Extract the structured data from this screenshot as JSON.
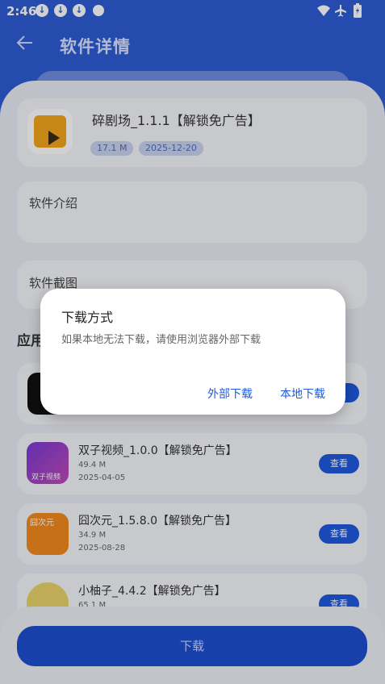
{
  "status_bar": {
    "time": "2:46"
  },
  "header": {
    "title": "软件详情"
  },
  "app": {
    "name": "碎剧场_1.1.1【解锁免广告】",
    "size": "17.1 M",
    "date": "2025-12-20"
  },
  "sections": {
    "intro": "软件介绍",
    "screenshots": "软件截图",
    "related_prefix": "应用"
  },
  "related": [
    {
      "name": "双子视频_1.0.0【解锁免广告】",
      "size": "49.4 M",
      "date": "2025-04-05",
      "icon_text": "双子视频",
      "button": "查看"
    },
    {
      "name": "囧次元_1.5.8.0【解锁免广告】",
      "size": "34.9 M",
      "date": "2025-08-28",
      "icon_text": "囧次元",
      "button": "查看"
    },
    {
      "name": "小柚子_4.4.2【解锁免广告】",
      "size": "65.1 M",
      "date": "",
      "button": "查看"
    }
  ],
  "bottom": {
    "download_label": "下载"
  },
  "dialog": {
    "title": "下载方式",
    "message": "如果本地无法下载，请使用浏览器外部下载",
    "external_button": "外部下载",
    "local_button": "本地下载"
  },
  "colors": {
    "header_bg": "#2f5cd6",
    "accent": "#1e5ae0",
    "sheet_bg": "#e9ecf5"
  }
}
